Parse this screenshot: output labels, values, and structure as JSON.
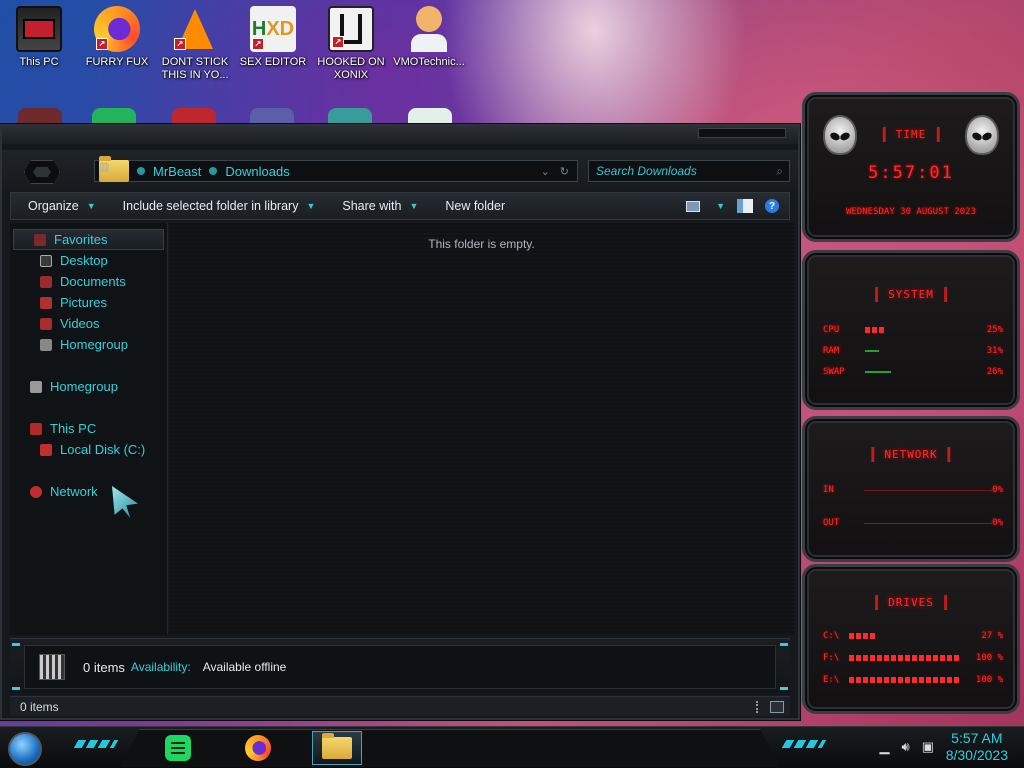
{
  "desktop_icons": [
    {
      "label": "This PC"
    },
    {
      "label": "FURRY FUX"
    },
    {
      "label": "DONT STICK THIS IN YO..."
    },
    {
      "label": "SEX EDITOR"
    },
    {
      "label": "HOOKED ON XONIX"
    },
    {
      "label": "VMOTechnic..."
    }
  ],
  "explorer": {
    "address": {
      "crumbs": [
        "MrBeast",
        "Downloads"
      ]
    },
    "search_placeholder": "Search Downloads",
    "toolbar": {
      "organize": "Organize",
      "include": "Include selected folder in library",
      "share": "Share with",
      "new_folder": "New folder",
      "help": "?"
    },
    "nav": {
      "favorites": "Favorites",
      "desktop": "Desktop",
      "documents": "Documents",
      "pictures": "Pictures",
      "videos": "Videos",
      "homegroup_fav": "Homegroup",
      "homegroup": "Homegroup",
      "this_pc": "This PC",
      "local_disk": "Local Disk (C:)",
      "network": "Network"
    },
    "empty_message": "This folder is empty.",
    "details": {
      "count": "0 items",
      "availability_label": "Availability:",
      "availability_value": "Available offline"
    },
    "status": "0 items"
  },
  "widgets": {
    "time": {
      "title": "TIME",
      "clock": "5:57:01",
      "date": "WEDNESDAY 30 AUGUST 2023"
    },
    "system": {
      "title": "SYSTEM",
      "rows": [
        {
          "label": "CPU",
          "value": "25%",
          "percent": 25
        },
        {
          "label": "RAM",
          "value": "31%",
          "percent": 31
        },
        {
          "label": "SWAP",
          "value": "26%",
          "percent": 26
        }
      ]
    },
    "network": {
      "title": "NETWORK",
      "rows": [
        {
          "label": "IN",
          "value": "0%"
        },
        {
          "label": "OUT",
          "value": "0%"
        }
      ]
    },
    "drives": {
      "title": "DRIVES",
      "rows": [
        {
          "label": "C:\\",
          "value": "27 %",
          "percent": 27
        },
        {
          "label": "F:\\",
          "value": "100 %",
          "percent": 100
        },
        {
          "label": "E:\\",
          "value": "100 %",
          "percent": 100
        }
      ]
    },
    "accent": "#ff2b2b"
  },
  "taskbar": {
    "apps": [
      "spotify-icon",
      "firefox-icon",
      "file-explorer-icon"
    ],
    "time": "5:57 AM",
    "date": "8/30/2023"
  },
  "colors": {
    "cyan_accent": "#35d0dc",
    "red_accent": "#ff2b2b"
  }
}
